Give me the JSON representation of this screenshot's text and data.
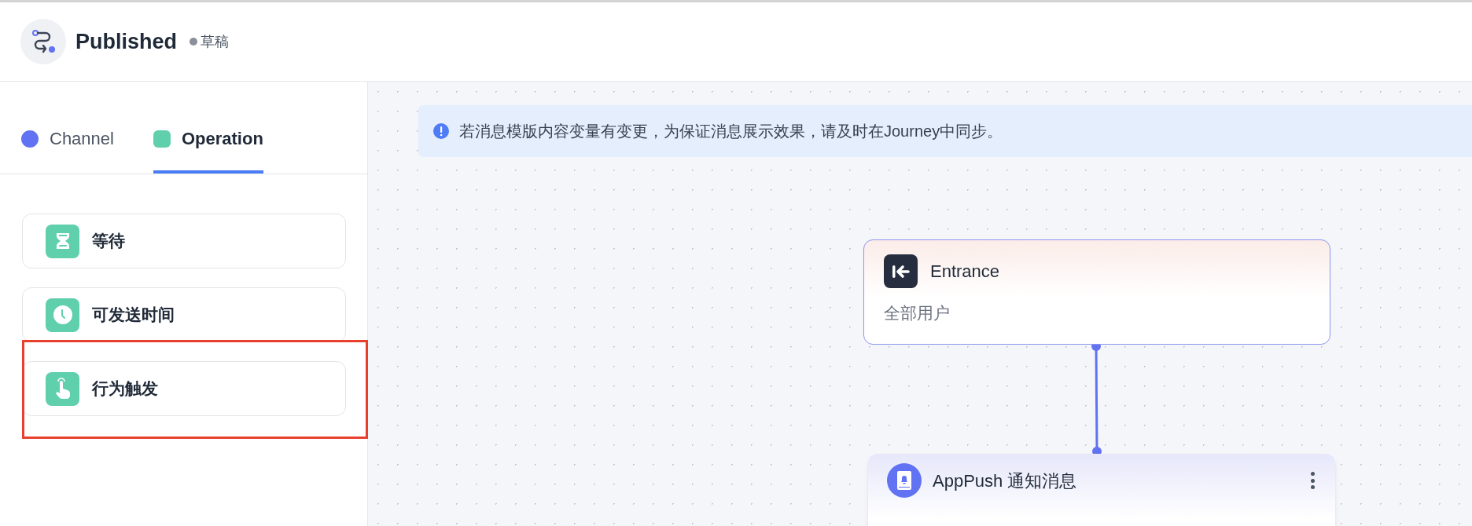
{
  "header": {
    "title": "Published",
    "status": {
      "label": "草稿",
      "color": "#8a8f99"
    }
  },
  "sidebar": {
    "tabs": [
      {
        "label": "Channel",
        "color": "#6172f3",
        "selected": false
      },
      {
        "label": "Operation",
        "color": "#5fcfac",
        "selected": true
      }
    ],
    "items": [
      {
        "label": "等待",
        "kind": "hourglass",
        "highlighted": false
      },
      {
        "label": "可发送时间",
        "kind": "clock",
        "highlighted": false
      },
      {
        "label": "行为触发",
        "kind": "tap",
        "highlighted": true
      }
    ]
  },
  "canvas": {
    "notice": "若消息模版内容变量有变更，为保证消息展示效果，请及时在Journey中同步。",
    "nodes": [
      {
        "kind": "entrance",
        "title": "Entrance",
        "subtitle": "全部用户"
      },
      {
        "kind": "apppush",
        "title": "AppPush 通知消息"
      }
    ]
  }
}
